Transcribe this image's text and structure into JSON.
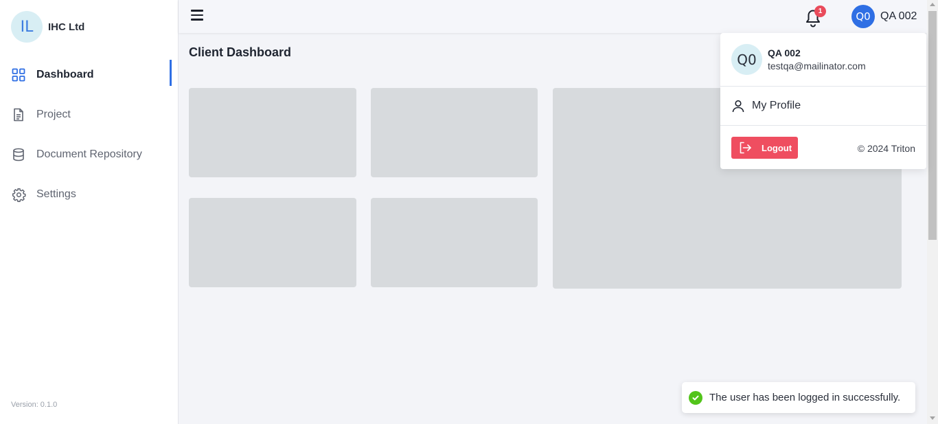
{
  "sidebar": {
    "org": {
      "initials": "IL",
      "name": "IHC Ltd"
    },
    "items": [
      {
        "label": "Dashboard",
        "icon": "grid-icon",
        "active": true
      },
      {
        "label": "Project",
        "icon": "document-icon",
        "active": false
      },
      {
        "label": "Document Repository",
        "icon": "database-icon",
        "active": false
      },
      {
        "label": "Settings",
        "icon": "gear-icon",
        "active": false
      }
    ],
    "version": "Version:  0.1.0"
  },
  "topbar": {
    "menu_icon": "hamburger-icon",
    "notifications": {
      "icon": "bell-icon",
      "count": "1"
    },
    "user": {
      "initials": "Q0",
      "name": "QA 002"
    }
  },
  "main": {
    "title": "Client Dashboard"
  },
  "dropdown": {
    "initials": "Q0",
    "name": "QA 002",
    "email": "testqa@mailinator.com",
    "profile_label": "My Profile",
    "logout_label": "Logout",
    "copyright": "© 2024 Triton"
  },
  "toast": {
    "message": "The user has been logged in successfully.",
    "icon": "check-circle-icon"
  },
  "colors": {
    "accent": "#2f6fe4",
    "danger": "#ef4e60",
    "success": "#52c41a",
    "skeleton": "#d7dadd"
  }
}
